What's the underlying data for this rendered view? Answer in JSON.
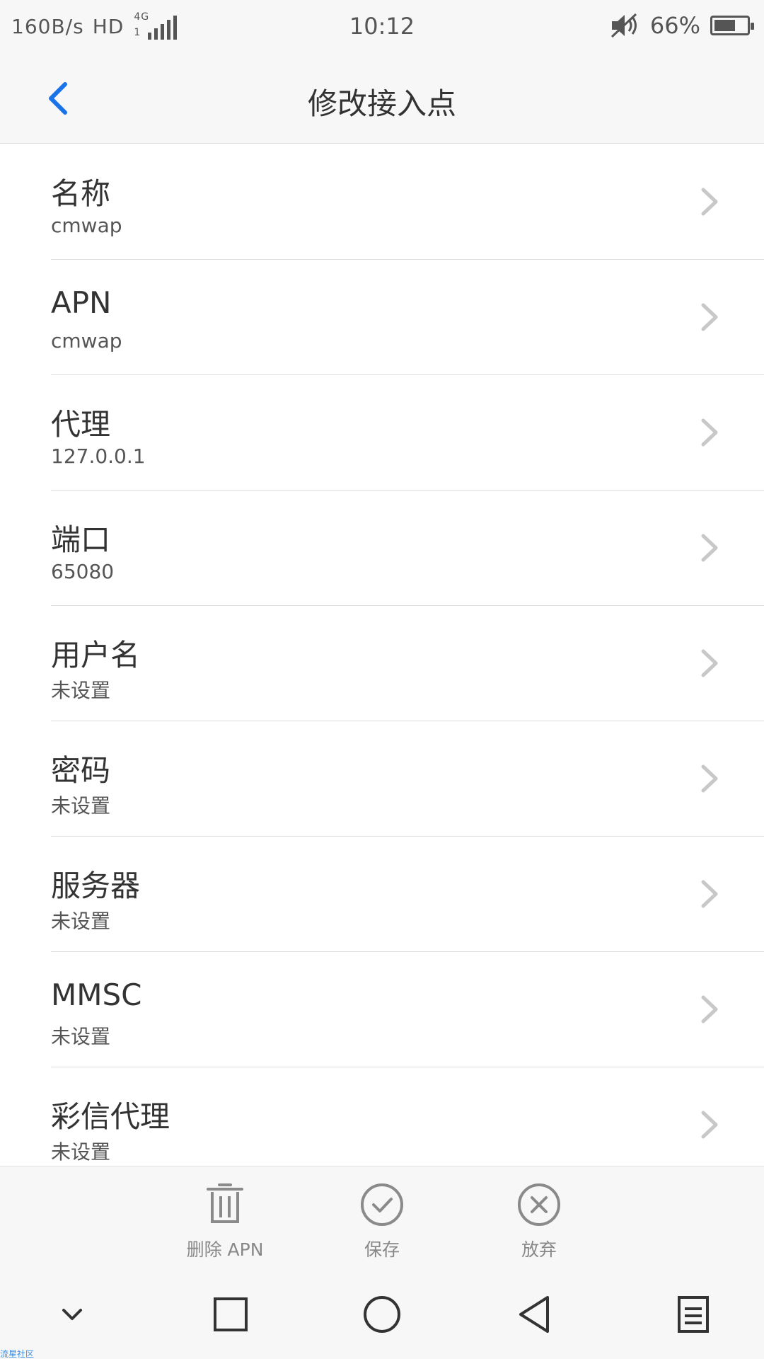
{
  "status_bar": {
    "net_speed": "160B/s",
    "hd": "HD",
    "network_type": "4G",
    "sim_slot": "1",
    "time": "10:12",
    "battery": "66%",
    "battery_level": 0.66,
    "icons": [
      "signal-icon",
      "mute-icon",
      "battery-icon"
    ]
  },
  "header": {
    "title": "修改接入点",
    "back_icon": "back-chevron-icon",
    "accent_color": "#1a73e8"
  },
  "fields": [
    {
      "label": "名称",
      "value": "cmwap"
    },
    {
      "label": "APN",
      "value": "cmwap"
    },
    {
      "label": "代理",
      "value": "127.0.0.1"
    },
    {
      "label": "端口",
      "value": "65080"
    },
    {
      "label": "用户名",
      "value": "未设置"
    },
    {
      "label": "密码",
      "value": "未设置"
    },
    {
      "label": "服务器",
      "value": "未设置"
    },
    {
      "label": "MMSC",
      "value": "未设置"
    },
    {
      "label": "彩信代理",
      "value": "未设置"
    }
  ],
  "actions": {
    "delete": {
      "label": "删除 APN",
      "icon": "trash-icon"
    },
    "save": {
      "label": "保存",
      "icon": "check-circle-icon"
    },
    "discard": {
      "label": "放弃",
      "icon": "close-circle-icon"
    }
  },
  "nav_bar": {
    "icons": [
      "collapse-chevron-icon",
      "recents-square-icon",
      "home-circle-icon",
      "back-triangle-icon",
      "menu-icon"
    ]
  },
  "watermark": "流星社区"
}
